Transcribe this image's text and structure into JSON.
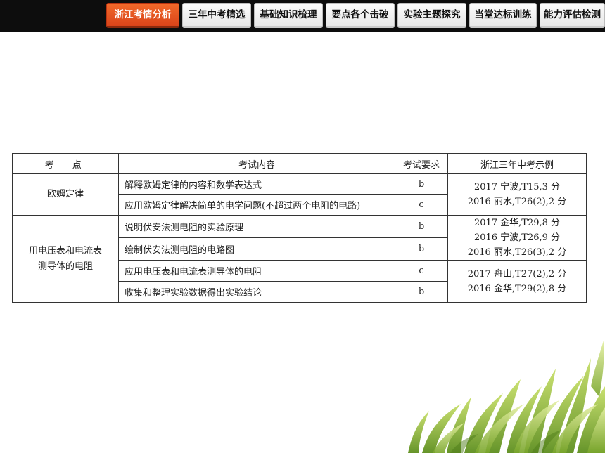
{
  "nav": {
    "tabs": [
      {
        "label": "浙江考情分析",
        "active": true
      },
      {
        "label": "三年中考精选",
        "active": false
      },
      {
        "label": "基础知识梳理",
        "active": false
      },
      {
        "label": "要点各个击破",
        "active": false
      },
      {
        "label": "实验主题探究",
        "active": false
      },
      {
        "label": "当堂达标训练",
        "active": false
      },
      {
        "label": "能力评估检测",
        "active": false
      }
    ]
  },
  "table": {
    "headers": [
      "考　点",
      "考试内容",
      "考试要求",
      "浙江三年中考示例"
    ],
    "groups": [
      {
        "point_lines": [
          "欧姆定律"
        ],
        "rows": [
          {
            "content": "解释欧姆定律的内容和数学表达式",
            "requirement": "b"
          },
          {
            "content": "应用欧姆定律解决简单的电学问题(不超过两个电阻的电路)",
            "requirement": "c"
          }
        ],
        "examples": [
          {
            "lines": [
              "2017 宁波,T15,3 分",
              "2016 丽水,T26(2),2 分"
            ]
          }
        ]
      },
      {
        "point_lines": [
          "用电压表和电流表",
          "测导体的电阻"
        ],
        "rows": [
          {
            "content": "说明伏安法测电阻的实验原理",
            "requirement": "b"
          },
          {
            "content": "绘制伏安法测电阻的电路图",
            "requirement": "b"
          },
          {
            "content": "应用电压表和电流表测导体的电阻",
            "requirement": "c"
          },
          {
            "content": "收集和整理实验数据得出实验结论",
            "requirement": "b"
          }
        ],
        "examples": [
          {
            "lines": [
              "2017 金华,T29,8 分",
              "2016 宁波,T26,9 分",
              "2016 丽水,T26(3),2 分"
            ]
          },
          {
            "lines": [
              "2017 舟山,T27(2),2 分",
              "2016 金华,T29(2),8 分"
            ]
          }
        ]
      }
    ]
  },
  "colors": {
    "topbar": "#0d0d0d",
    "active_tab": "#e4501f",
    "tab": "#f2f2f2",
    "border": "#333333",
    "grass": "#8fbf3a"
  }
}
